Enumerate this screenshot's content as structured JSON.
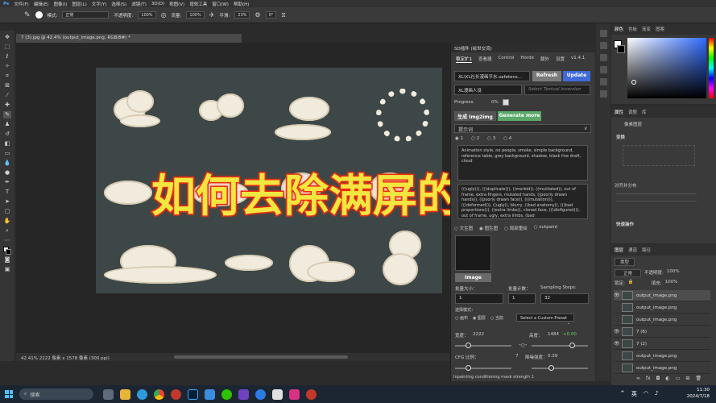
{
  "menubar": {
    "items": [
      "文件(F)",
      "编辑(E)",
      "图像(I)",
      "图层(L)",
      "文字(Y)",
      "选择(S)",
      "滤镜(T)",
      "3D(D)",
      "视图(V)",
      "增效工具",
      "窗口(W)",
      "帮助(H)"
    ]
  },
  "options": {
    "mode_label": "模式:",
    "mode_value": "正常",
    "opacity_label": "不透明度:",
    "opacity_value": "100%",
    "flow_label": "流量:",
    "flow_value": "100%",
    "smooth_label": "平滑:",
    "smooth_value": "23%",
    "angle_value": "0°"
  },
  "document": {
    "tab_title": "7 (3).jpg @ 42.4% (output_image.png, RGB/8#) *",
    "status": "42.41%   2222 像素 x 1578 像素 (300 ppi)"
  },
  "overlay_title": "如何去除满屏的水印",
  "sd_panel": {
    "title": "SD插件 (绘世交流)",
    "tabs": [
      "稳定扩1",
      "查看器",
      "Control",
      "Horde",
      "额外",
      "设置",
      "v1.4.1"
    ],
    "model_value": "XL\\XL社长漫画平水.safetens...",
    "refresh_label": "Refresh",
    "update_label": "Update",
    "lora_value": "XL漫画人设",
    "textual_placeholder": "Select Textual Inversion",
    "progress_label": "Progress.",
    "progress_value": "0%",
    "generate_label": "生成 Img2img",
    "generate_more_label": "Generate more",
    "prompt_header": "提示词",
    "radio_options": [
      "1",
      "2",
      "3",
      "4"
    ],
    "positive_prompt": "Animation style, no people, smoke, simple background, reference table, grey background, shadow, black line draft, cloud",
    "negative_prompt": "(((ugly))), (((duplicate))), ((morbid)), ((mutilated)), out of frame, extra fingers, mutated hands, ((poorly drawn hands)), ((poorly drawn face)), (((mutation))), (((deformed))), ((ugly)), blurry, ((bad anatomy)), (((bad proportions))), ((extra limbs)), cloned face, (((disfigured))), out of frame, ugly, extra limbs, (bad",
    "mode_options": [
      "文生图",
      "图生图",
      "局部重绘",
      "outpaint"
    ],
    "image_button": "Image",
    "batch_size_label": "批量大小：",
    "batch_size_value": "1",
    "batch_count_label": "批量计数：",
    "batch_count_value": "1",
    "steps_label": "Sampling Steps:",
    "steps_value": "32",
    "select_mode_label": "选择模式：",
    "select_options": [
      "画布",
      "图层",
      "当前"
    ],
    "preset_value": "Select a Custom Preset",
    "width_label": "宽度：",
    "width_value": "2222",
    "height_label": "高度：",
    "height_value": "1484",
    "ratio_value": "+0.00",
    "cfg_label": "CFG 比例：",
    "cfg_value": "7",
    "denoise_label": "降噪强度：",
    "denoise_value": "0.39",
    "mask_label": "Inpainting conditioning mask strength 1"
  },
  "right_panels": {
    "color_tabs": [
      "颜色",
      "色板",
      "渐变",
      "图案"
    ],
    "props_tabs": [
      "属性",
      "调整",
      "库"
    ],
    "props_title": "像素图层",
    "transform_label": "变换",
    "align_label": "对齐并分布",
    "quick_label": "快速操作",
    "layers_tabs": [
      "图层",
      "通道",
      "路径"
    ],
    "kind_label": "类型",
    "blend_value": "正常",
    "opacity_label": "不透明度:",
    "opacity_value": "100%",
    "lock_label": "锁定:",
    "fill_label": "填充:",
    "fill_value": "100%",
    "layers": [
      "output_image.png",
      "output_image.png",
      "output_image.png",
      "7 (6)",
      "7 (2)",
      "output_image.png",
      "output_image.png"
    ]
  },
  "taskbar": {
    "search_placeholder": "搜索",
    "lang": "英",
    "time": "11:30",
    "date": "2024/7/18"
  }
}
